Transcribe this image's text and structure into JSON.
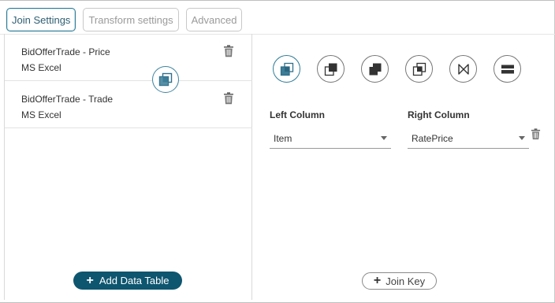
{
  "tabs": [
    {
      "label": "Join Settings",
      "active": true
    },
    {
      "label": "Transform settings",
      "active": false
    },
    {
      "label": "Advanced",
      "active": false
    }
  ],
  "data_tables": [
    {
      "name": "BidOfferTrade - Price",
      "source": "MS Excel",
      "icon": "trash-icon"
    },
    {
      "name": "BidOfferTrade - Trade",
      "source": "MS Excel",
      "icon": "trash-icon"
    }
  ],
  "join_badge_icon": "inner-join-icon",
  "join_types": [
    {
      "icon": "inner-join-icon",
      "selected": true
    },
    {
      "icon": "left-outer-join-icon",
      "selected": false
    },
    {
      "icon": "right-outer-join-icon",
      "selected": false
    },
    {
      "icon": "full-outer-join-icon",
      "selected": false
    },
    {
      "icon": "cross-join-icon",
      "selected": false
    },
    {
      "icon": "union-icon",
      "selected": false
    }
  ],
  "join_key": {
    "left_column_label": "Left Column",
    "right_column_label": "Right Column",
    "left_value": "Item",
    "right_value": "RatePrice"
  },
  "buttons": {
    "add_data_table": "Add Data Table",
    "join_key": "Join Key"
  },
  "colors": {
    "accent": "#0e566f",
    "selected_ring": "#2d7c98",
    "icon_fill_selected": "#3c7d98",
    "icon_fill_dark": "#333333"
  }
}
